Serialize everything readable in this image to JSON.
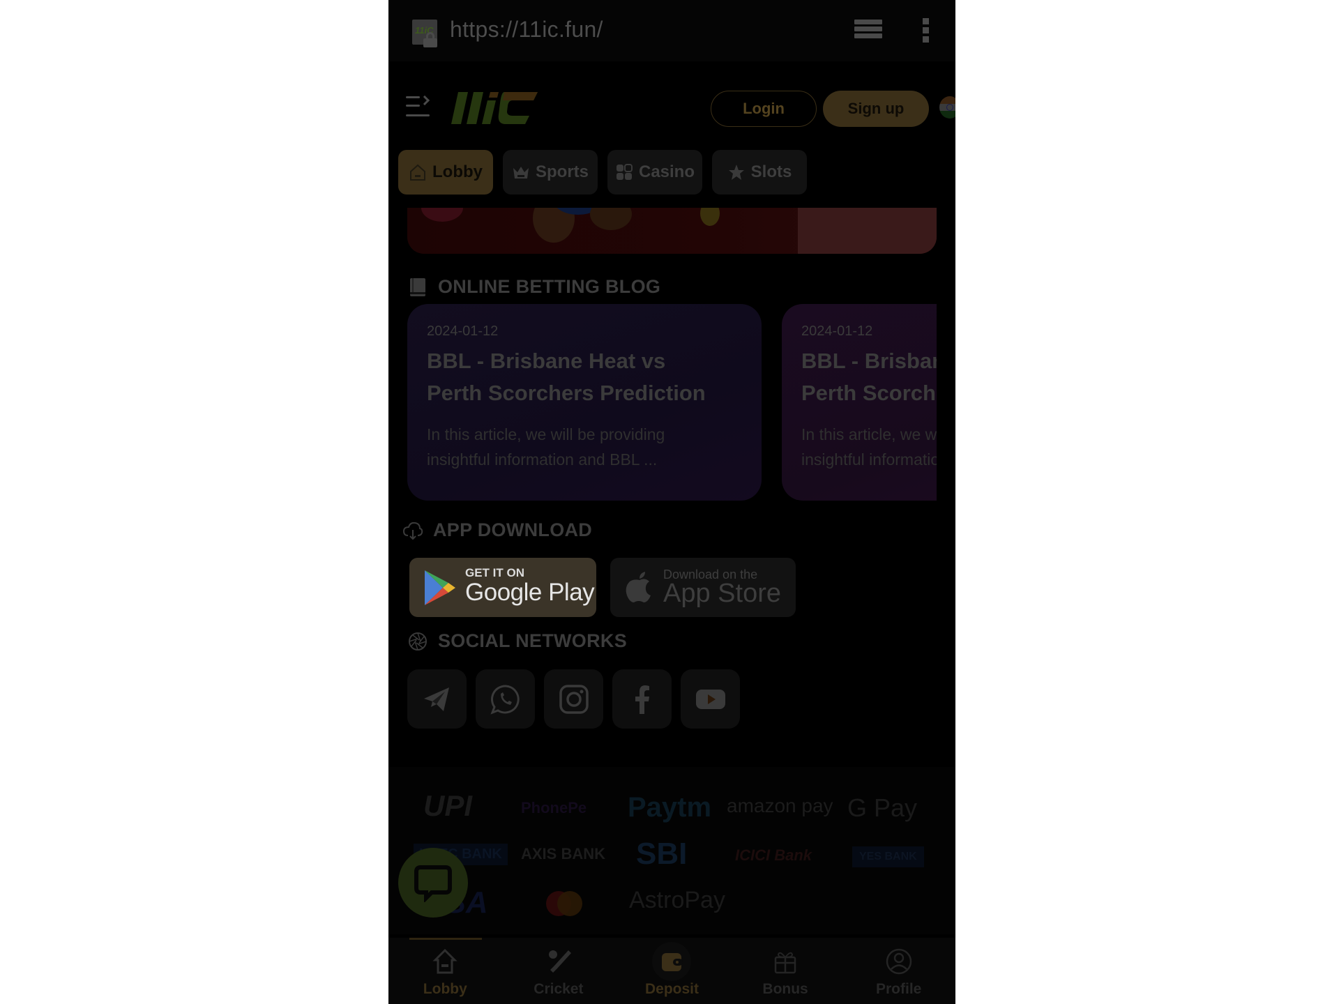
{
  "browser": {
    "url": "https://11ic.fun/",
    "favicon_text": "11iC"
  },
  "header": {
    "logo_text": "11iC",
    "login_label": "Login",
    "signup_label": "Sign up",
    "language_flag": "India"
  },
  "category_tabs": [
    {
      "label": "Lobby",
      "icon": "home-icon",
      "active": true
    },
    {
      "label": "Sports",
      "icon": "crown-icon",
      "active": false
    },
    {
      "label": "Casino",
      "icon": "grid-icon",
      "active": false
    },
    {
      "label": "Slots",
      "icon": "star-icon",
      "active": false
    }
  ],
  "blog": {
    "heading": "ONLINE BETTING BLOG",
    "posts": [
      {
        "date": "2024-01-12",
        "title_line1": "BBL - Brisbane Heat vs",
        "title_line2": "Perth Scorchers Prediction",
        "excerpt_line1": "In this article, we will be providing",
        "excerpt_line2": "insightful information and BBL ..."
      },
      {
        "date": "2024-01-12",
        "title_line1": "BBL - Brisbane Heat vs",
        "title_line2": "Perth Scorchers Prediction",
        "excerpt_line1": "In this article, we will be providing",
        "excerpt_line2": "insightful information and BBL ..."
      }
    ]
  },
  "app_download": {
    "heading": "APP DOWNLOAD",
    "google_play_small": "GET IT ON",
    "google_play_big": "Google Play",
    "app_store_small": "Download on the",
    "app_store_big": "App Store"
  },
  "social": {
    "heading": "SOCIAL NETWORKS",
    "networks": [
      "telegram",
      "whatsapp",
      "instagram",
      "facebook",
      "youtube"
    ]
  },
  "payments": {
    "row1": [
      "UPI",
      "PhonePe",
      "Paytm",
      "amazon pay",
      "G Pay"
    ],
    "row2": [
      "HDFC BANK",
      "AXIS BANK",
      "SBI",
      "ICICI Bank",
      "YES BANK"
    ],
    "row3": [
      "VISA",
      "Mastercard",
      "AstroPay"
    ]
  },
  "bottom_nav": [
    {
      "label": "Lobby",
      "icon": "home-icon",
      "active": true
    },
    {
      "label": "Cricket",
      "icon": "cricket-icon",
      "active": false
    },
    {
      "label": "Deposit",
      "icon": "wallet-icon",
      "active": false
    },
    {
      "label": "Bonus",
      "icon": "gift-icon",
      "active": false
    },
    {
      "label": "Profile",
      "icon": "user-icon",
      "active": false
    }
  ],
  "colors": {
    "accent": "#c9a14f",
    "brand_green": "#3d5a1c",
    "brand_orange": "#b5671a"
  }
}
